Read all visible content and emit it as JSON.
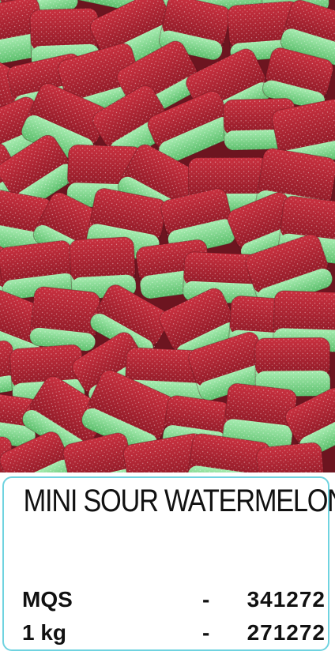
{
  "product": {
    "title": "MINI SOUR WATERMELON",
    "photo_icon": "watermelon-candy-photo"
  },
  "codes": [
    {
      "label": "MQS",
      "separator": "-",
      "code": "341272"
    },
    {
      "label": "1 kg",
      "separator": "-",
      "code": "271272"
    }
  ],
  "colors": {
    "candy_red": "#b52433",
    "candy_green": "#7fd58a",
    "border": "#6fd3e0"
  }
}
